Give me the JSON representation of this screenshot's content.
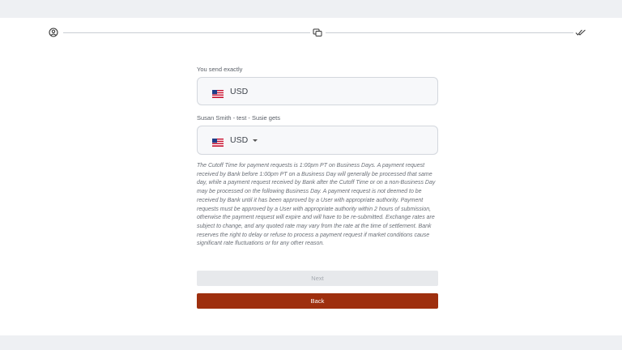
{
  "stepper": {
    "icons": [
      "user-icon",
      "exchange-icon",
      "double-check-icon"
    ]
  },
  "send": {
    "label": "You send exactly",
    "currency": "USD",
    "flag": "us-flag-icon"
  },
  "receive": {
    "label": "Susan Smith - test - Susie gets",
    "currency": "USD",
    "flag": "us-flag-icon"
  },
  "disclaimer": "The Cutoff Time for payment requests is 1:00pm PT on Business Days. A payment request received by Bank before 1:00pm PT on a Business Day will generally be processed that same day, while a payment request received by Bank after the Cutoff Time or on a non-Business Day may be processed on the following Business Day. A payment request is not deemed to be received by Bank until it has been approved by a User with appropriate authority. Payment requests must be approved by a User with appropriate authority within 2 hours of submission, otherwise the payment request will expire and will have to be re-submitted. Exchange rates are subject to change, and any quoted rate may vary from the rate at the time of settlement. Bank reserves the right to delay or refuse to process a payment request if market conditions cause significant rate fluctuations or for any other reason.",
  "buttons": {
    "next": "Next",
    "back": "Back"
  },
  "colors": {
    "back_button": "#9e2f0e",
    "next_button_disabled": "#e7e9ec"
  }
}
